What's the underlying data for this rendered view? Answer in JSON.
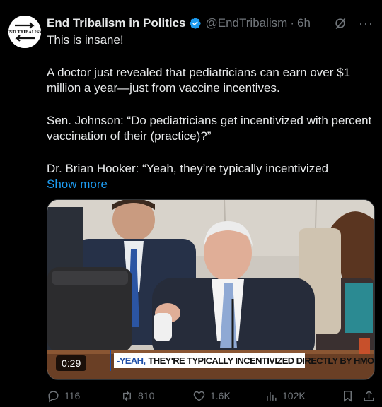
{
  "author": {
    "name": "End Tribalism in Politics",
    "handle": "@EndTribalism",
    "time": "6h",
    "avatar_text": "End Tribalism"
  },
  "post": {
    "paragraphs": [
      "This is insane!",
      "A doctor just revealed that pediatricians can earn over $1 million a year—just from vaccine incentives.",
      "Sen. Johnson: “Do pediatricians get incentivized with percent vaccination of their (practice)?”",
      "Dr. Brian Hooker: “Yeah, they’re typically incentivized"
    ],
    "show_more": "Show more"
  },
  "media": {
    "duration": "0:29",
    "caption_prefix": "-YEAH,",
    "caption_rest": "THEY'RE TYPICALLY INCENTIVIZED DIRECTLY BY HMOS."
  },
  "actions": {
    "replies": "116",
    "reposts": "810",
    "likes": "1.6K",
    "views": "102K"
  },
  "icons": {
    "verified": "verified-badge-icon",
    "grok": "grok-icon",
    "more": "more-icon",
    "reply": "reply-icon",
    "repost": "repost-icon",
    "like": "heart-icon",
    "views": "views-chart-icon",
    "bookmark": "bookmark-icon",
    "share": "share-icon"
  },
  "colors": {
    "accent": "#1d9bf0",
    "muted": "#71767b",
    "text": "#e7e9ea",
    "background": "#000000"
  }
}
